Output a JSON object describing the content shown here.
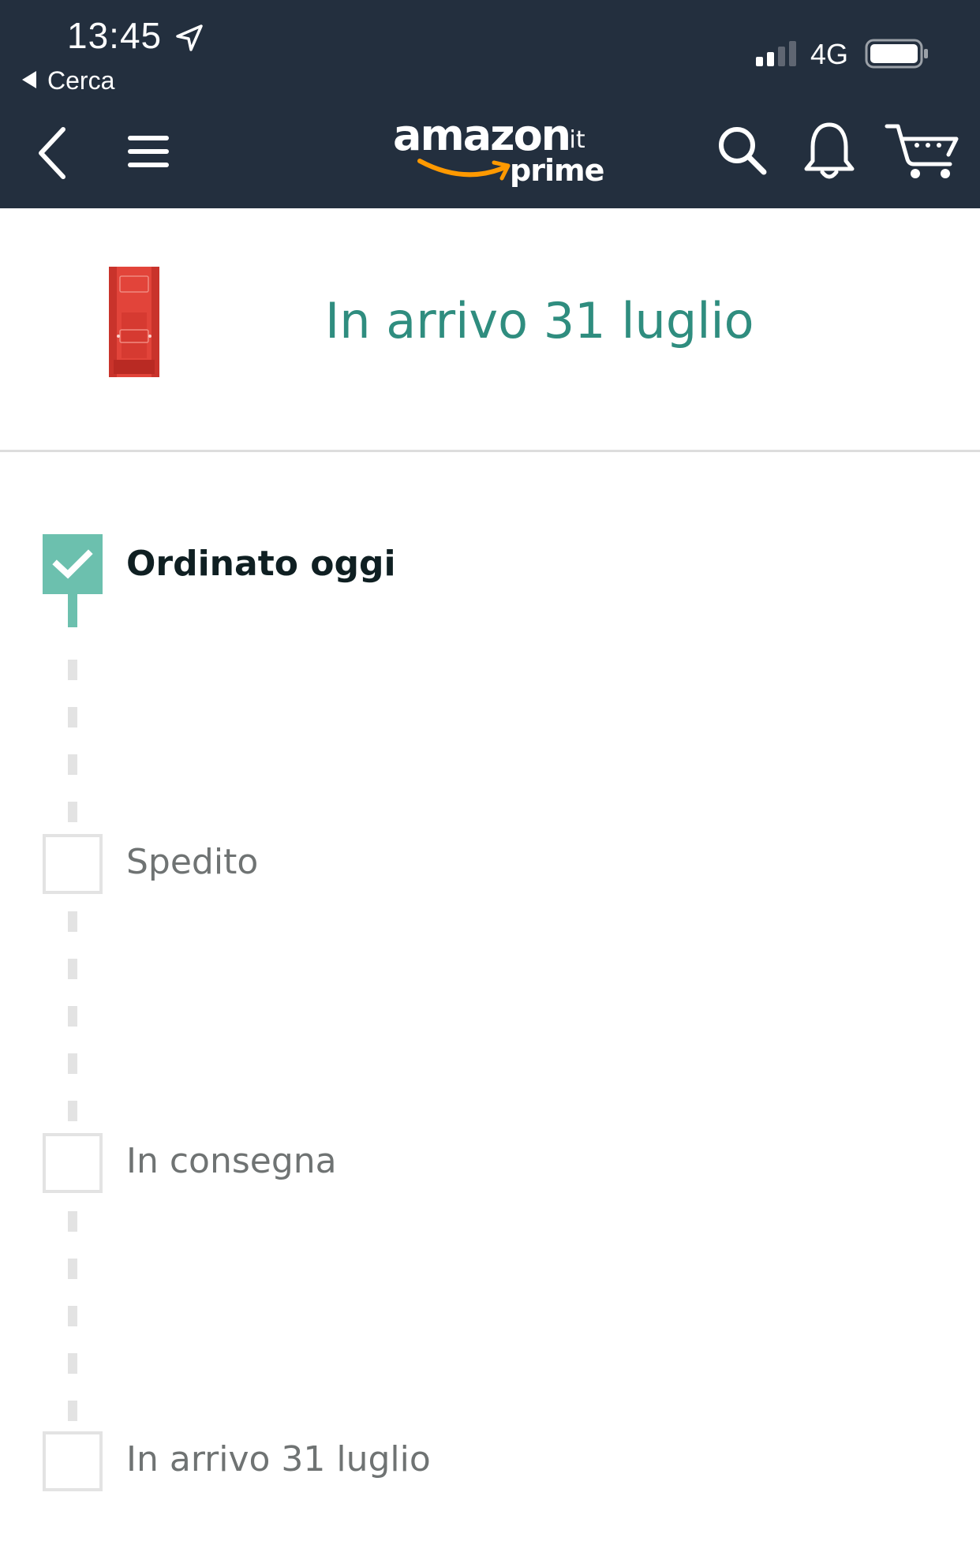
{
  "status_bar": {
    "time": "13:45",
    "back_to_app": "Cerca",
    "network": "4G"
  },
  "header": {
    "logo": {
      "wordmark": "amazon",
      "tld": ".it",
      "tier": "prime"
    },
    "icons": [
      "back-icon",
      "menu-icon",
      "search-icon",
      "bell-icon",
      "cart-icon"
    ]
  },
  "delivery": {
    "headline": "In arrivo 31 luglio"
  },
  "tracking": {
    "steps": [
      {
        "label": "Ordinato oggi",
        "completed": true
      },
      {
        "label": "Spedito",
        "completed": false
      },
      {
        "label": "In consegna",
        "completed": false
      },
      {
        "label": "In arrivo 31 luglio",
        "completed": false
      }
    ]
  },
  "colors": {
    "header_bg": "#232f3e",
    "accent_teal": "#2f8d7f",
    "step_done": "#6cc0ae",
    "step_pending": "#e3e3e3",
    "smile_orange": "#f90"
  }
}
